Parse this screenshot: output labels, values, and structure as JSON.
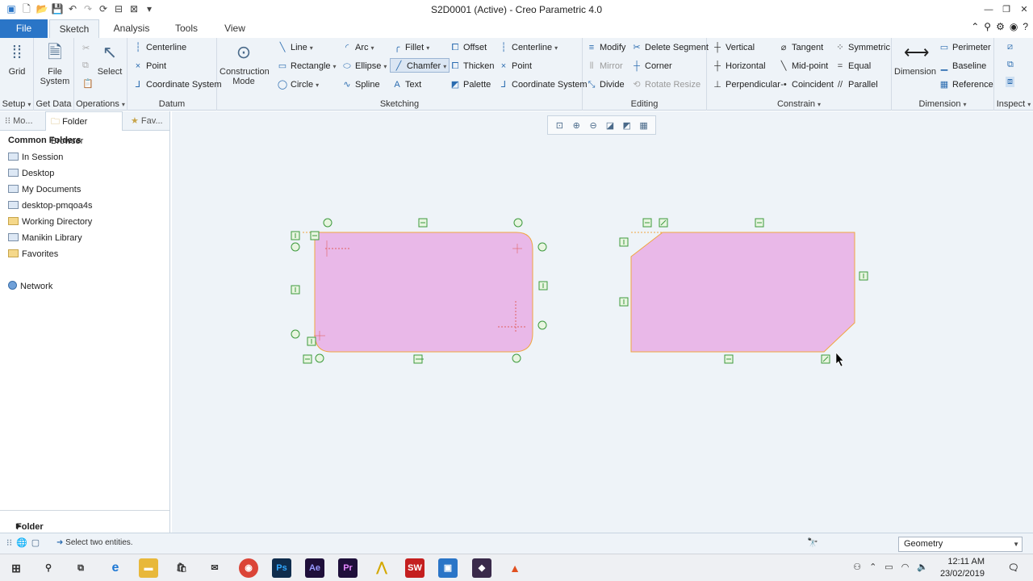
{
  "window": {
    "title": "S2D0001 (Active) - Creo Parametric 4.0",
    "controls": [
      "—",
      "❐",
      "✕"
    ]
  },
  "tabs": [
    {
      "label": "File"
    },
    {
      "label": "Sketch"
    },
    {
      "label": "Analysis"
    },
    {
      "label": "Tools"
    },
    {
      "label": "View"
    }
  ],
  "ribbon": {
    "setup": {
      "grid": "Grid",
      "label": "Setup"
    },
    "get_data": {
      "file_system_line1": "File",
      "file_system_line2": "System",
      "label": "Get Data"
    },
    "operations": {
      "select": "Select",
      "label": "Operations"
    },
    "datum": {
      "centerline": "Centerline",
      "point": "Point",
      "coordinate_system": "Coordinate System",
      "label": "Datum"
    },
    "construction": {
      "line1": "Construction",
      "line2": "Mode"
    },
    "sketching": {
      "line": "Line",
      "arc": "Arc",
      "fillet": "Fillet",
      "offset": "Offset",
      "centerline": "Centerline",
      "rectangle": "Rectangle",
      "ellipse": "Ellipse",
      "chamfer": "Chamfer",
      "thicken": "Thicken",
      "point": "Point",
      "circle": "Circle",
      "spline": "Spline",
      "text": "Text",
      "palette": "Palette",
      "coordinate_system": "Coordinate System",
      "label": "Sketching"
    },
    "editing": {
      "modify": "Modify",
      "delete_segment": "Delete Segment",
      "mirror": "Mirror",
      "corner": "Corner",
      "divide": "Divide",
      "rotate_resize": "Rotate Resize",
      "label": "Editing"
    },
    "constrain": {
      "vertical": "Vertical",
      "tangent": "Tangent",
      "symmetric": "Symmetric",
      "horizontal": "Horizontal",
      "midpoint": "Mid-point",
      "equal": "Equal",
      "perpendicular": "Perpendicular",
      "coincident": "Coincident",
      "parallel": "Parallel",
      "label": "Constrain"
    },
    "dimension": {
      "dimension": "Dimension",
      "perimeter": "Perimeter",
      "baseline": "Baseline",
      "reference": "Reference",
      "label": "Dimension"
    },
    "inspect": {
      "label": "Inspect"
    }
  },
  "left_panel": {
    "tabs": [
      "Mo...",
      "Folder Browser",
      "Fav..."
    ],
    "header": "Common Folders",
    "items": [
      "In Session",
      "Desktop",
      "My Documents",
      "desktop-pmqoa4s",
      "Working Directory",
      "Manikin Library",
      "Favorites"
    ],
    "network": "Network",
    "footer": "Folder Tree"
  },
  "status": {
    "message": "Select two entities.",
    "filter": "Geometry"
  },
  "taskbar": {
    "time": "12:11 AM",
    "date": "23/02/2019",
    "apps": [
      "Ps",
      "Ae",
      "Pr",
      "SW"
    ]
  },
  "colors": {
    "accent": "#2a75c7",
    "sketch_fill": "#e9b8e8",
    "sketch_stroke": "#f0a640",
    "constraint": "#3d9a3d"
  }
}
